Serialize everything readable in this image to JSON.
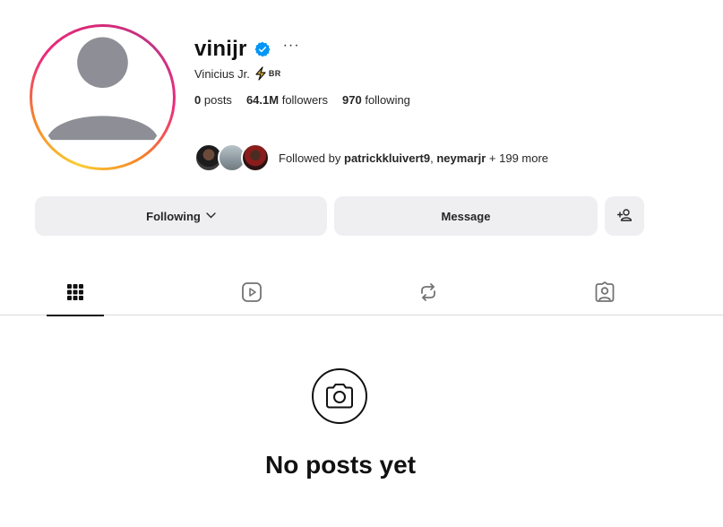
{
  "profile": {
    "username": "vinijr",
    "verified_icon": "verified-badge-icon",
    "more_label": "···",
    "full_name": "Vinicius Jr.",
    "country_badge": "BR",
    "colors": {
      "verified": "#0095f6",
      "ring_start": "#f9ce34",
      "ring_mid": "#ee2a7b",
      "ring_end": "#c13584"
    }
  },
  "stats": {
    "posts_count": "0",
    "posts_label": "posts",
    "followers_count": "64.1M",
    "followers_label": "followers",
    "following_count": "970",
    "following_label": "following"
  },
  "followed_by": {
    "prefix": "Followed by",
    "user1": "patrickkluivert9",
    "separator": ",",
    "user2": "neymarjr",
    "suffix": "+ 199 more"
  },
  "actions": {
    "following_label": "Following",
    "message_label": "Message",
    "add_user_icon": "add-user-icon"
  },
  "tabs": [
    {
      "name": "grid",
      "icon": "grid-icon",
      "active": true
    },
    {
      "name": "reels",
      "icon": "reels-icon",
      "active": false
    },
    {
      "name": "reposts",
      "icon": "repost-icon",
      "active": false
    },
    {
      "name": "tagged",
      "icon": "tagged-icon",
      "active": false
    }
  ],
  "empty_state": {
    "icon": "camera-icon",
    "title": "No posts yet"
  }
}
